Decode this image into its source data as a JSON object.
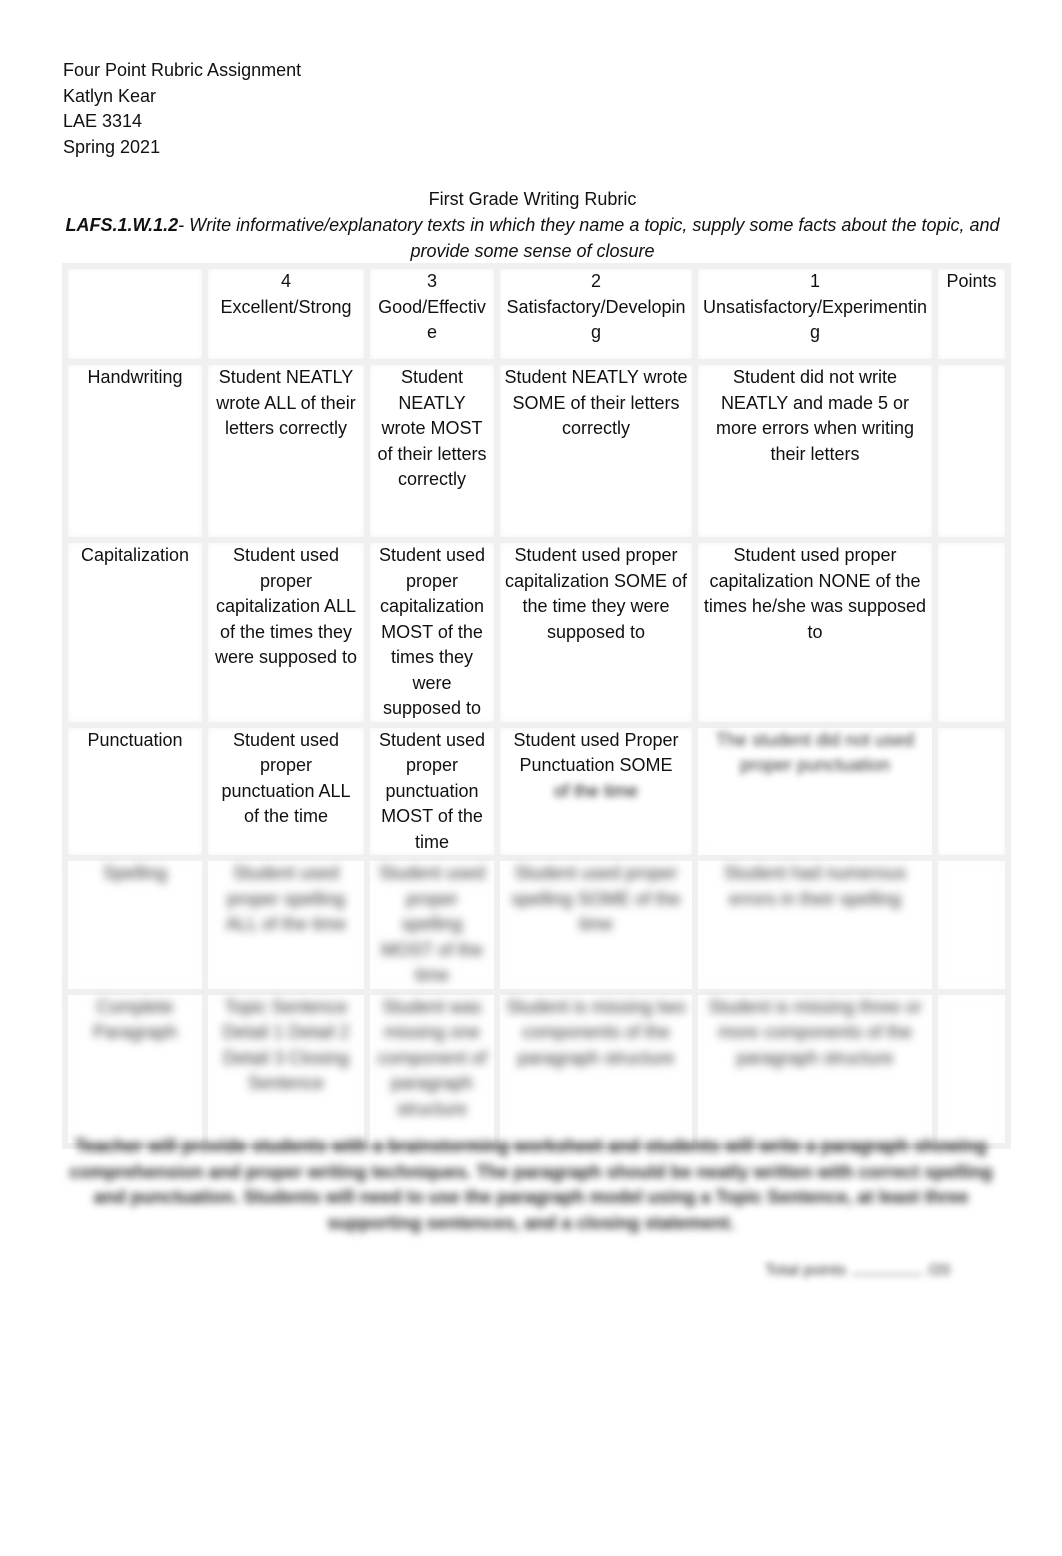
{
  "header": {
    "assignment": "Four Point Rubric Assignment",
    "author": "Katlyn Kear",
    "course": "LAE 3314",
    "term": "Spring 2021"
  },
  "title": {
    "heading": "First Grade Writing Rubric",
    "standard_code": "LAFS.1.W.1.2",
    "standard_text": "- Write informative/explanatory texts in which they name a topic, supply some facts about the topic, and provide some sense of closure"
  },
  "rubric": {
    "columns": [
      {
        "score": "",
        "label": ""
      },
      {
        "score": "4",
        "label": "Excellent/Strong"
      },
      {
        "score": "3",
        "label": "Good/Effective"
      },
      {
        "score": "2",
        "label": "Satisfactory/Developing"
      },
      {
        "score": "1",
        "label": "Unsatisfactory/Experimenting"
      },
      {
        "score": "",
        "label": "Points"
      }
    ],
    "rows": [
      {
        "criterion": "Handwriting",
        "cells": [
          "Student NEATLY wrote ALL of their letters correctly",
          "Student NEATLY wrote MOST of their letters correctly",
          "Student NEATLY wrote SOME of their letters correctly",
          "Student did not write NEATLY and made 5 or more errors when writing their letters"
        ],
        "points": ""
      },
      {
        "criterion": "Capitalization",
        "cells": [
          "Student used proper capitalization ALL of the times they were supposed to",
          "Student used proper capitalization MOST of the times they were supposed to",
          "Student used proper capitalization SOME of the time they were supposed to",
          "Student used proper capitalization NONE of the times he/she was supposed to"
        ],
        "points": ""
      },
      {
        "criterion": "Punctuation",
        "cells": [
          "Student used proper punctuation ALL of the time",
          "Student used proper punctuation MOST of the time",
          "Student used Proper Punctuation SOME",
          ""
        ],
        "cells_blurred": [
          "",
          "",
          "of the time",
          "The student did not used proper punctuation"
        ],
        "points": ""
      },
      {
        "criterion": "Spelling",
        "blurred": true,
        "cells": [
          "Student used proper spelling ALL of the time",
          "Student used proper spelling MOST of the time",
          "Student used proper spelling SOME of the time",
          "Student had numerous errors in their spelling"
        ],
        "points": ""
      },
      {
        "criterion": "Complete Paragraph",
        "blurred": true,
        "cells": [
          "Topic Sentence Detail 1 Detail 2 Detail 3 Closing Sentence",
          "Student was missing one component of paragraph structure",
          "Student is missing two components of the paragraph structure",
          "Student is missing three or more components of the paragraph structure"
        ],
        "points": ""
      }
    ]
  },
  "footer": {
    "note": "Teacher will provide students with a brainstorming worksheet and students will write a paragraph showing comprehension and proper writing techniques. The paragraph should be neatly written with correct spelling and punctuation. Students will need to use the paragraph model using a Topic Sentence, at least three supporting sentences, and a closing statement.",
    "total_label": "Total points",
    "total_max": "/20"
  }
}
